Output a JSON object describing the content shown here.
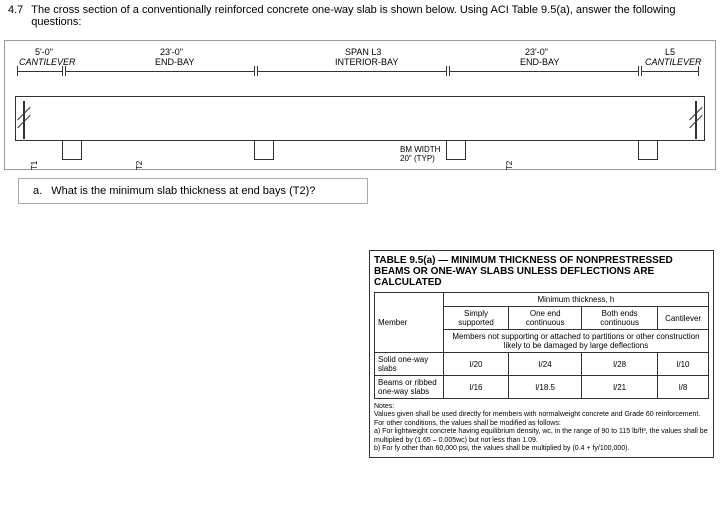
{
  "problem": {
    "number": "4.7",
    "text": "The cross section of a conventionally reinforced concrete one-way slab is shown below. Using ACI Table 9.5(a), answer the following questions:"
  },
  "diagram": {
    "spans": {
      "s1_dim": "5'-0\"",
      "s1_label": "CANTILEVER",
      "s2_dim": "23'-0\"",
      "s2_label": "END-BAY",
      "s3_label_top": "SPAN L3",
      "s3_label": "INTERIOR-BAY",
      "s4_dim": "23'-0\"",
      "s4_label": "END-BAY",
      "s5_label_top": "L5",
      "s5_label": "CANTILEVER"
    },
    "beam_width_label": "BM WIDTH",
    "beam_width_dim": "20\" (TYP)",
    "t1": "T1",
    "t2": "T2",
    "t2b": "T2"
  },
  "question_a": {
    "letter": "a.",
    "text": "What is the minimum slab thickness at end bays (T2)?"
  },
  "table": {
    "title": "TABLE 9.5(a) — MINIMUM THICKNESS OF NONPRESTRESSED BEAMS OR ONE-WAY SLABS UNLESS DEFLECTIONS ARE CALCULATED",
    "header_top": "Minimum thickness, h",
    "cols": {
      "member": "Member",
      "c1": "Simply supported",
      "c2": "One end continuous",
      "c3": "Both ends continuous",
      "c4": "Cantilever"
    },
    "subheader": "Members not supporting or attached to partitions or other construction likely to be damaged by large deflections",
    "rows": [
      {
        "name": "Solid one-way slabs",
        "v1": "l/20",
        "v2": "l/24",
        "v3": "l/28",
        "v4": "l/10"
      },
      {
        "name": "Beams or ribbed one-way slabs",
        "v1": "l/16",
        "v2": "l/18.5",
        "v3": "l/21",
        "v4": "l/8"
      }
    ],
    "notes_header": "Notes:",
    "notes_intro": "Values given shall be used directly for members with normalweight concrete and Grade 60 reinforcement. For other conditions, the values shall be modified as follows:",
    "notes_a": "a) For lightweight concrete having equilibrium density, wc, in the range of 90 to 115 lb/ft³, the values shall be multiplied by (1.65 – 0.005wc) but not less than 1.09.",
    "notes_b": "b) For fy other than 60,000 psi, the values shall be multiplied by (0.4 + fy/100,000)."
  },
  "chart_data": {
    "type": "table",
    "title": "ACI Table 9.5(a) Minimum Thickness h",
    "columns": [
      "Member",
      "Simply supported",
      "One end continuous",
      "Both ends continuous",
      "Cantilever"
    ],
    "rows": [
      [
        "Solid one-way slabs",
        "l/20",
        "l/24",
        "l/28",
        "l/10"
      ],
      [
        "Beams or ribbed one-way slabs",
        "l/16",
        "l/18.5",
        "l/21",
        "l/8"
      ]
    ]
  }
}
